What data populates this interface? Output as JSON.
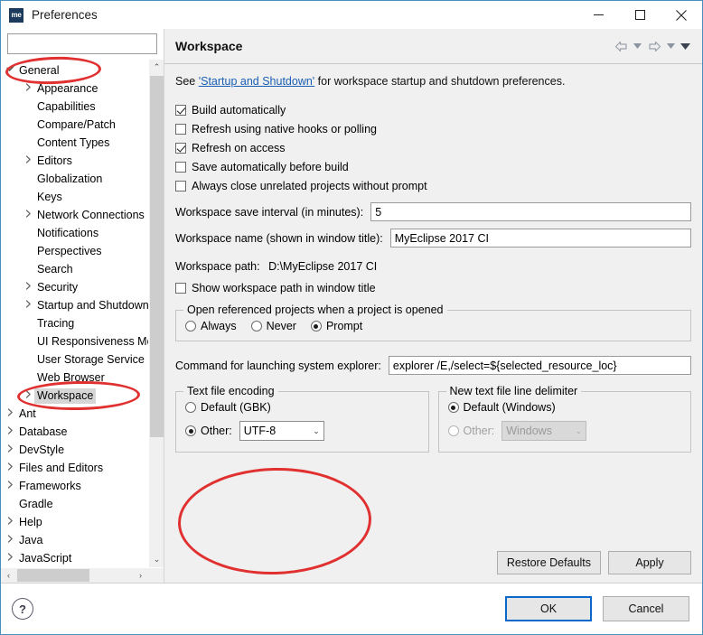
{
  "window": {
    "title": "Preferences",
    "logo_text": "me",
    "controls": {
      "minimize": "─",
      "maximize": "☐",
      "close": "✕"
    }
  },
  "sidebar": {
    "filter_value": "",
    "filter_placeholder": "",
    "items": [
      {
        "label": "General",
        "level": 0,
        "twisty": "expanded",
        "selected": false
      },
      {
        "label": "Appearance",
        "level": 1,
        "twisty": "collapsed",
        "selected": false
      },
      {
        "label": "Capabilities",
        "level": 1,
        "twisty": "none",
        "selected": false
      },
      {
        "label": "Compare/Patch",
        "level": 1,
        "twisty": "none",
        "selected": false
      },
      {
        "label": "Content Types",
        "level": 1,
        "twisty": "none",
        "selected": false
      },
      {
        "label": "Editors",
        "level": 1,
        "twisty": "collapsed",
        "selected": false
      },
      {
        "label": "Globalization",
        "level": 1,
        "twisty": "none",
        "selected": false
      },
      {
        "label": "Keys",
        "level": 1,
        "twisty": "none",
        "selected": false
      },
      {
        "label": "Network Connections",
        "level": 1,
        "twisty": "collapsed",
        "selected": false
      },
      {
        "label": "Notifications",
        "level": 1,
        "twisty": "none",
        "selected": false
      },
      {
        "label": "Perspectives",
        "level": 1,
        "twisty": "none",
        "selected": false
      },
      {
        "label": "Search",
        "level": 1,
        "twisty": "none",
        "selected": false
      },
      {
        "label": "Security",
        "level": 1,
        "twisty": "collapsed",
        "selected": false
      },
      {
        "label": "Startup and Shutdown",
        "level": 1,
        "twisty": "collapsed",
        "selected": false
      },
      {
        "label": "Tracing",
        "level": 1,
        "twisty": "none",
        "selected": false
      },
      {
        "label": "UI Responsiveness Monitoring",
        "level": 1,
        "twisty": "none",
        "selected": false
      },
      {
        "label": "User Storage Service",
        "level": 1,
        "twisty": "none",
        "selected": false
      },
      {
        "label": "Web Browser",
        "level": 1,
        "twisty": "none",
        "selected": false
      },
      {
        "label": "Workspace",
        "level": 1,
        "twisty": "collapsed",
        "selected": true
      },
      {
        "label": "Ant",
        "level": 0,
        "twisty": "collapsed",
        "selected": false
      },
      {
        "label": "Database",
        "level": 0,
        "twisty": "collapsed",
        "selected": false
      },
      {
        "label": "DevStyle",
        "level": 0,
        "twisty": "collapsed",
        "selected": false
      },
      {
        "label": "Files and Editors",
        "level": 0,
        "twisty": "collapsed",
        "selected": false
      },
      {
        "label": "Frameworks",
        "level": 0,
        "twisty": "collapsed",
        "selected": false
      },
      {
        "label": "Gradle",
        "level": 0,
        "twisty": "none",
        "selected": false
      },
      {
        "label": "Help",
        "level": 0,
        "twisty": "collapsed",
        "selected": false
      },
      {
        "label": "Java",
        "level": 0,
        "twisty": "collapsed",
        "selected": false
      },
      {
        "label": "JavaScript",
        "level": 0,
        "twisty": "collapsed",
        "selected": false
      }
    ],
    "scroll_up_icon": "⌃",
    "scroll_down_icon": "⌄",
    "scroll_left_icon": "‹",
    "scroll_right_icon": "›"
  },
  "page": {
    "title": "Workspace",
    "nav": {
      "back_icon": "⇦",
      "back_menu_icon": "▼",
      "forward_icon": "⇨",
      "forward_menu_icon": "▼",
      "view_menu_icon": "▼"
    },
    "intro_prefix": "See ",
    "intro_link": "'Startup and Shutdown'",
    "intro_suffix": " for workspace startup and shutdown preferences.",
    "checkboxes": [
      {
        "label": "Build automatically",
        "checked": true
      },
      {
        "label": "Refresh using native hooks or polling",
        "checked": false
      },
      {
        "label": "Refresh on access",
        "checked": true
      },
      {
        "label": "Save automatically before build",
        "checked": false
      },
      {
        "label": "Always close unrelated projects without prompt",
        "checked": false
      }
    ],
    "save_interval_label": "Workspace save interval (in minutes):",
    "save_interval_value": "5",
    "workspace_name_label": "Workspace name (shown in window title):",
    "workspace_name_value": "MyEclipse 2017 CI",
    "workspace_path_label": "Workspace path:",
    "workspace_path_value": "D:\\MyEclipse 2017 CI",
    "show_path_checkbox": {
      "label": "Show workspace path in window title",
      "checked": false
    },
    "referenced_group_title": "Open referenced projects when a project is opened",
    "referenced_options": [
      {
        "label": "Always",
        "selected": false
      },
      {
        "label": "Never",
        "selected": false
      },
      {
        "label": "Prompt",
        "selected": true
      }
    ],
    "explorer_label": "Command for launching system explorer:",
    "explorer_value": "explorer /E,/select=${selected_resource_loc}",
    "encoding_group_title": "Text file encoding",
    "encoding_default": {
      "label": "Default (GBK)",
      "selected": false
    },
    "encoding_other": {
      "label": "Other:",
      "selected": true,
      "value": "UTF-8",
      "arrow_icon": "⌄"
    },
    "delimiter_group_title": "New text file line delimiter",
    "delimiter_default": {
      "label": "Default (Windows)",
      "selected": true
    },
    "delimiter_other": {
      "label": "Other:",
      "selected": false,
      "value": "Windows",
      "arrow_icon": "⌄",
      "disabled": true
    },
    "restore_defaults_label": "Restore Defaults",
    "apply_label": "Apply"
  },
  "footer": {
    "help_icon_text": "?",
    "ok_label": "OK",
    "cancel_label": "Cancel"
  },
  "annotations": {
    "accent_color": "#e03030",
    "count": 3
  }
}
